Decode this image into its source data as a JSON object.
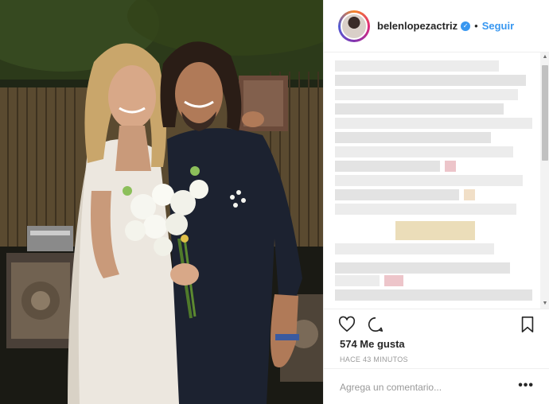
{
  "post": {
    "username": "belenlopezactriz",
    "verified_mark": "✓",
    "separator": "•",
    "follow_label": "Seguir",
    "likes": "574 Me gusta",
    "timestamp": "HACE 43 MINUTOS",
    "comment_placeholder": "Agrega un comentario...",
    "more_label": "•••"
  },
  "scrollbar": {
    "up_arrow": "▲",
    "down_arrow": "▼"
  },
  "icons": {
    "like": "heart-icon",
    "comment": "comment-icon",
    "save": "bookmark-icon",
    "more": "more-options-icon"
  },
  "colors": {
    "accent": "#3897f0",
    "text": "#262626",
    "muted": "#999999",
    "border": "#efefef"
  }
}
